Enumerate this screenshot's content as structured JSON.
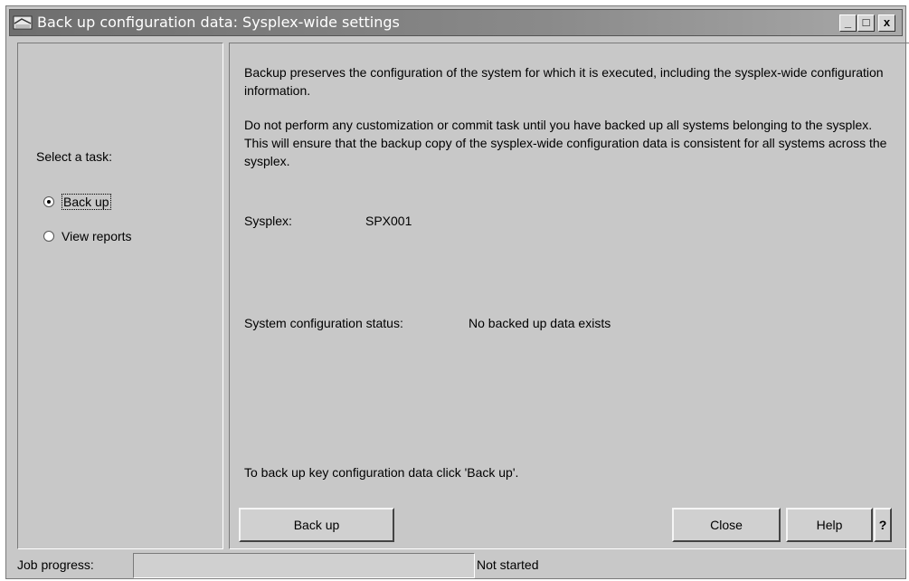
{
  "window": {
    "title": "Back up configuration data: Sysplex-wide settings",
    "controls": {
      "minimize": "_",
      "maximize": "□",
      "close": "x"
    },
    "icon": "config-app-icon"
  },
  "sidebar": {
    "label": "Select a task:",
    "tasks": [
      {
        "label": "Back up",
        "selected": true
      },
      {
        "label": "View reports",
        "selected": false
      }
    ]
  },
  "main": {
    "paragraph1": "Backup preserves the configuration of the system for which it is executed, including the sysplex-wide configuration information.",
    "paragraph2": "Do not perform any customization or commit task until you have backed up all systems belonging to the sysplex. This will ensure that the backup copy of the sysplex-wide configuration data is consistent for all systems across the sysplex.",
    "sysplex_label": "Sysplex:",
    "sysplex_value": "SPX001",
    "status_label": "System configuration status:",
    "status_value": "No backed up data exists",
    "footer_note": "To back up key configuration data click  'Back up'."
  },
  "buttons": {
    "backup": "Back up",
    "close": "Close",
    "help": "Help",
    "question": "?"
  },
  "status_bar": {
    "job_progress_label": "Job progress:",
    "job_progress_value": 0,
    "job_status": "Not started"
  },
  "colors": {
    "window_bg": "#c8c8c8",
    "titlebar": "#7a7a7a",
    "title_text": "#ffffff"
  }
}
